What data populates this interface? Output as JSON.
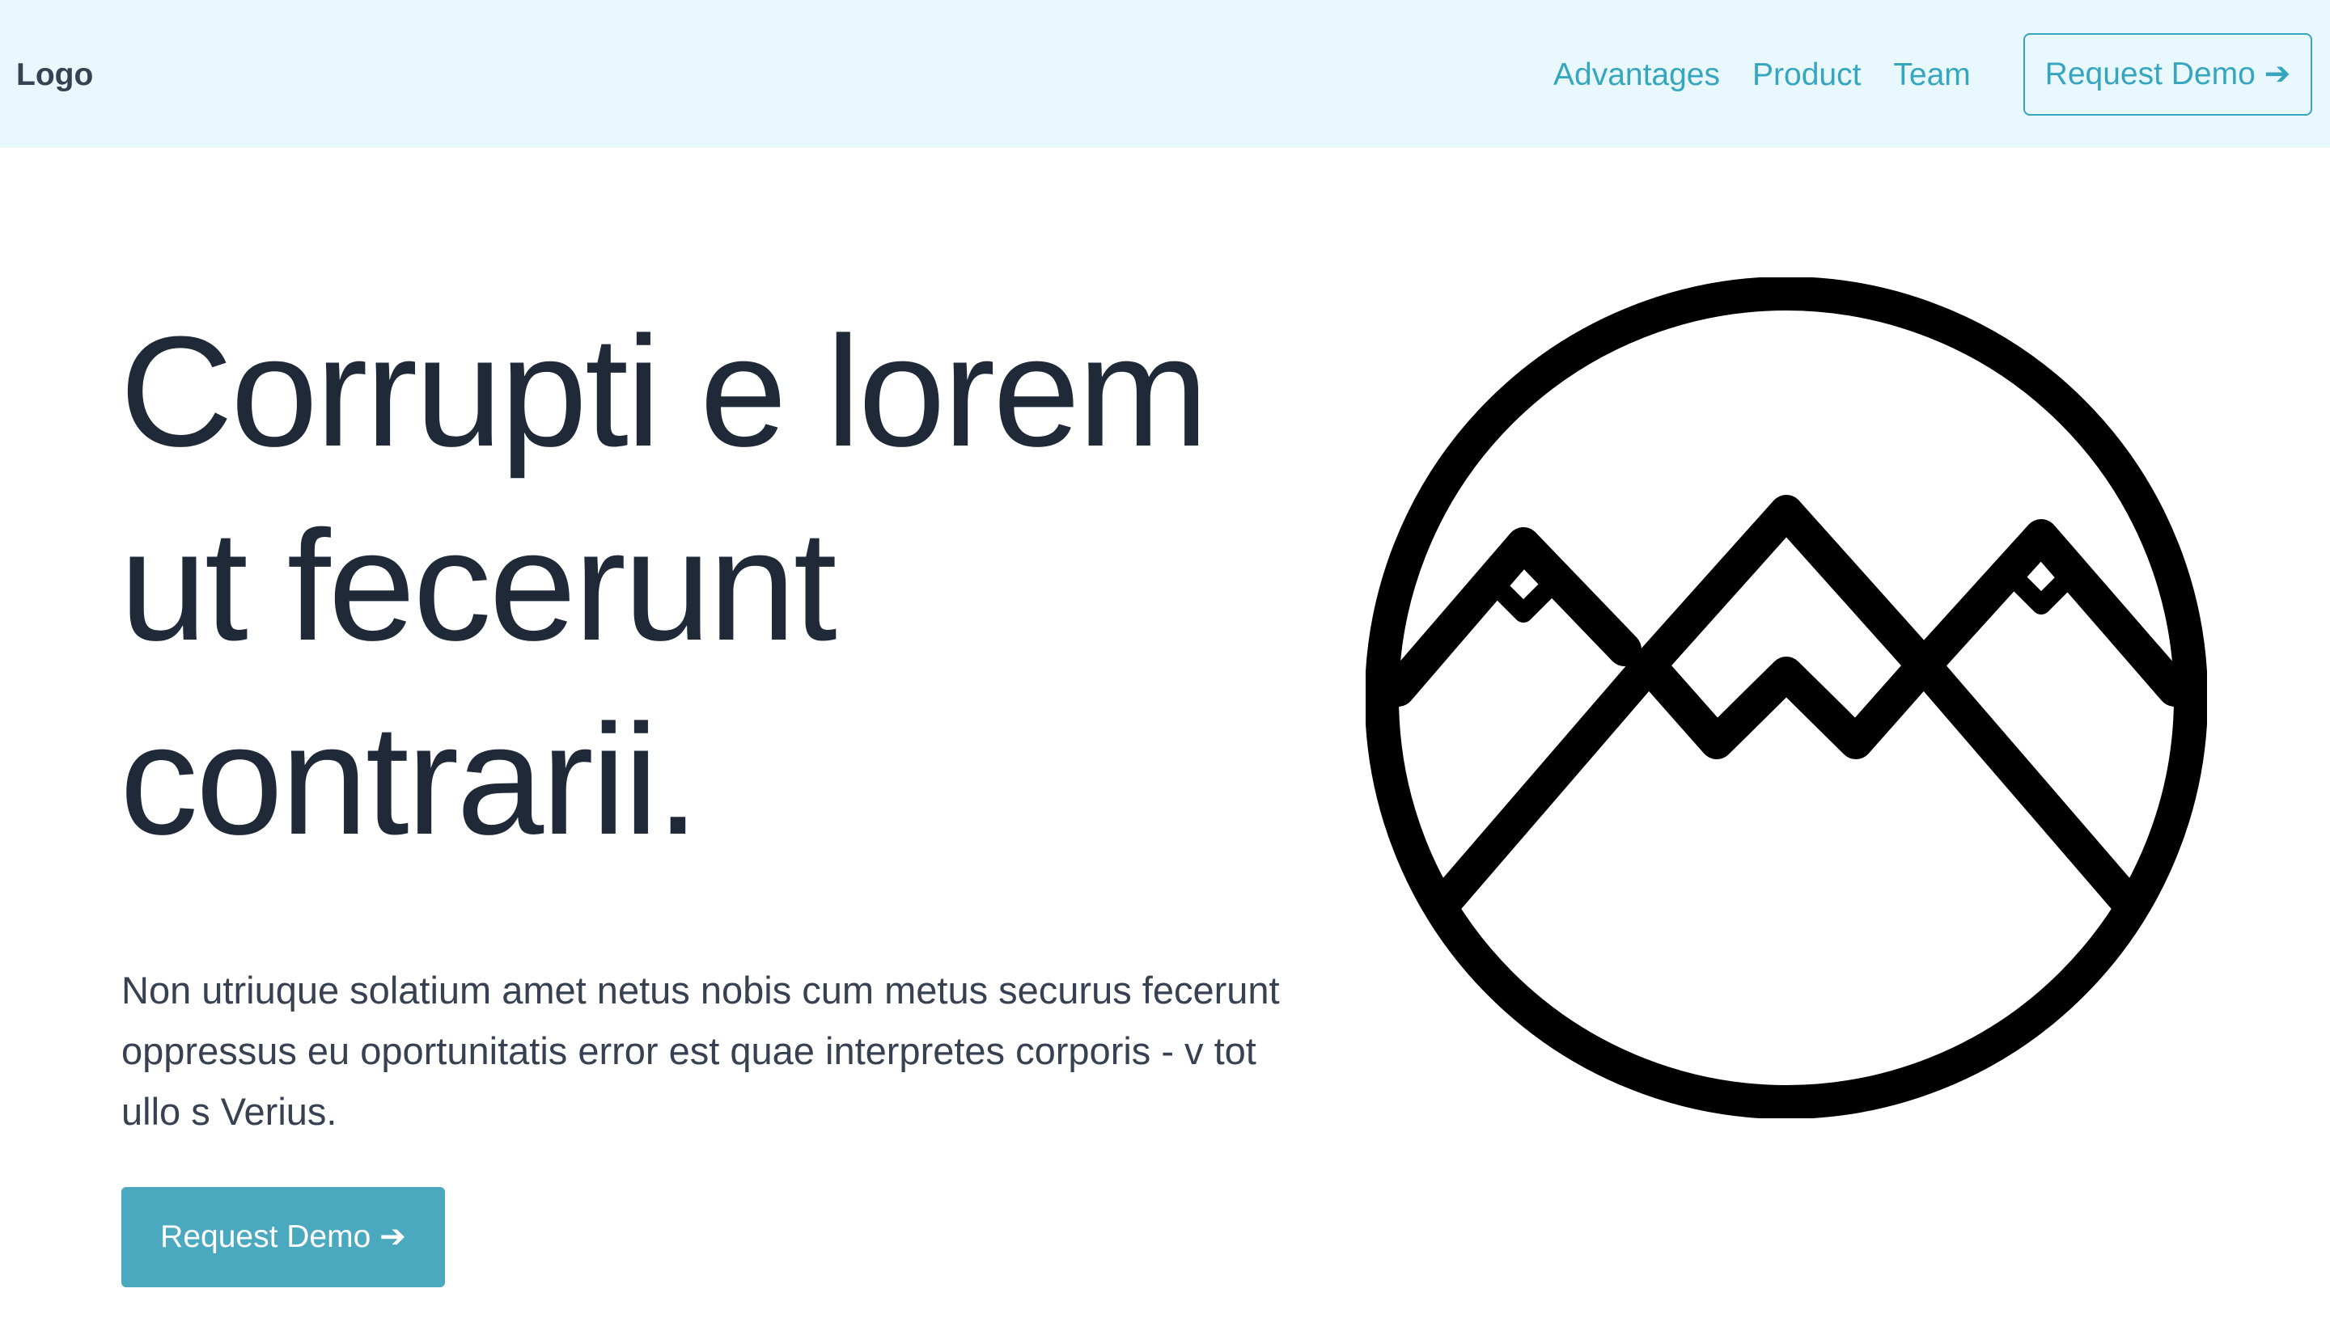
{
  "nav": {
    "logo": "Logo",
    "links": [
      "Advantages",
      "Product",
      "Team"
    ],
    "cta": "Request Demo ➔"
  },
  "hero": {
    "title_lines": [
      "Corrupti e lorem",
      "ut fecerunt",
      "contrarii."
    ],
    "paragraph": "Non utriuque solatium amet netus nobis cum metus securus fecerunt oppressus eu oportunitatis error est quae interpretes corporis - v tot ullo s Verius.",
    "cta": "Request Demo ➔",
    "illustration": "mountain-landscape-icon"
  },
  "colors": {
    "nav_background": "#e8f8fc",
    "accent": "#36a5bf",
    "button_fill": "#4ba9bf",
    "heading": "#1f2937",
    "body_text": "#374151"
  }
}
